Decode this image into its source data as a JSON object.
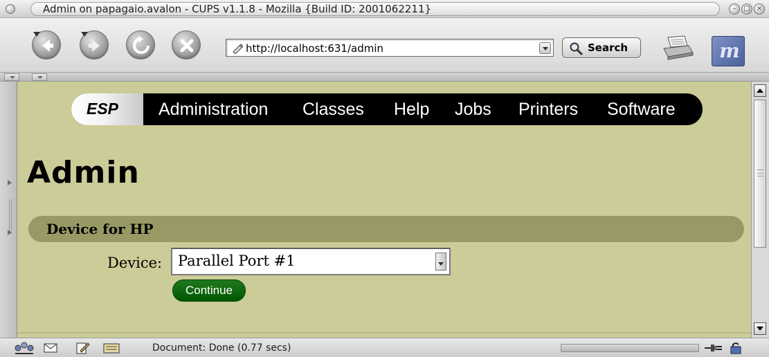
{
  "window": {
    "title": "Admin on papagaio.avalon - CUPS v1.1.8 - Mozilla {Build ID: 2001062211}"
  },
  "toolbar": {
    "url": "http://localhost:631/admin",
    "search_label": "Search",
    "icons": [
      "back-icon",
      "forward-icon",
      "reload-icon",
      "stop-icon",
      "print-icon",
      "mozilla-logo"
    ]
  },
  "navbar": {
    "brand": "ESP",
    "links": [
      "Administration",
      "Classes",
      "Help",
      "Jobs",
      "Printers",
      "Software"
    ]
  },
  "page": {
    "title": "Admin",
    "section_title": "Device for HP",
    "device_label": "Device:",
    "device_selected": "Parallel Port #1",
    "continue_label": "Continue"
  },
  "statusbar": {
    "text": "Document: Done (0.77 secs)"
  },
  "colors": {
    "page_bg": "#cccc99",
    "section_bar": "#999966",
    "nav_bg": "#000000",
    "continue_btn": "#006600"
  }
}
